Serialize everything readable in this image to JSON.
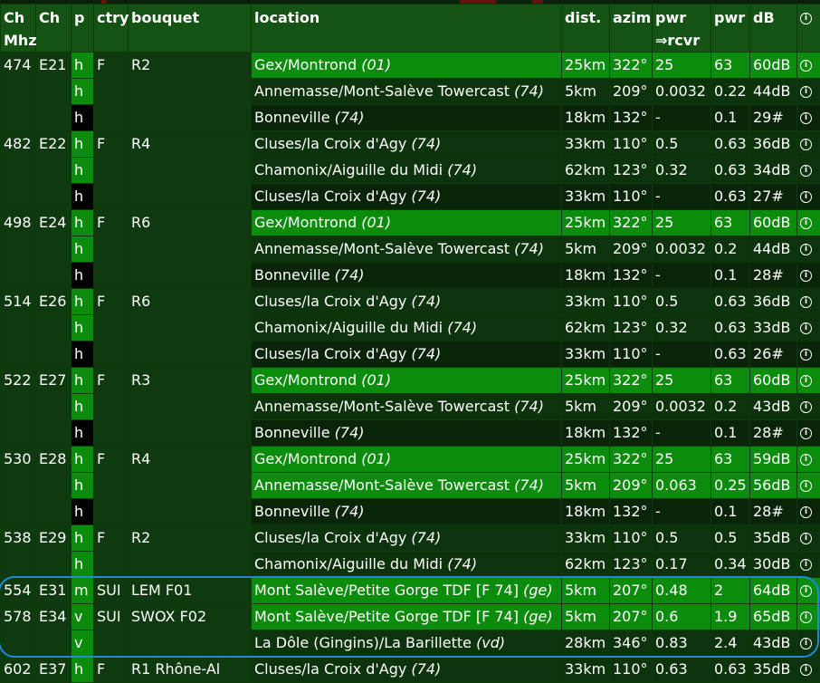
{
  "headers": {
    "ch_mhz_1": "Ch",
    "ch_mhz_2": "Mhz",
    "ch": "Ch",
    "p": "p",
    "ctry": "ctry",
    "bouquet": "bouquet",
    "location": "location",
    "dist": "dist.",
    "azim": "azim",
    "pwr_rcvr_1": "pwr",
    "pwr_rcvr_2": "⇒rcvr",
    "pwr": "pwr",
    "db": "dB",
    "info": "i"
  },
  "groups": [
    {
      "mhz": "474",
      "ch": "E21",
      "ctry": "F",
      "bouquet": "R2",
      "rows": [
        {
          "p": "h",
          "loc": "Gex/Montrond",
          "dept": "(01)",
          "dist": "25km",
          "azim": "322°",
          "pwr_rcvr": "25",
          "pwr": "63",
          "db": "60dB",
          "style": "bright"
        },
        {
          "p": "h",
          "loc": "Annemasse/Mont-Salève Towercast",
          "dept": "(74)",
          "dist": "5km",
          "azim": "209°",
          "pwr_rcvr": "0.0032",
          "pwr": "0.22",
          "db": "44dB",
          "style": "dim"
        },
        {
          "p": "h",
          "loc": "Bonneville",
          "dept": "(74)",
          "dist": "18km",
          "azim": "132°",
          "pwr_rcvr": "-",
          "pwr": "0.1",
          "db": "29#",
          "style": "dark"
        }
      ]
    },
    {
      "mhz": "482",
      "ch": "E22",
      "ctry": "F",
      "bouquet": "R4",
      "rows": [
        {
          "p": "h",
          "loc": "Cluses/la Croix d'Agy",
          "dept": "(74)",
          "dist": "33km",
          "azim": "110°",
          "pwr_rcvr": "0.5",
          "pwr": "0.63",
          "db": "36dB",
          "style": "dim"
        },
        {
          "p": "h",
          "loc": "Chamonix/Aiguille du Midi",
          "dept": "(74)",
          "dist": "62km",
          "azim": "123°",
          "pwr_rcvr": "0.32",
          "pwr": "0.63",
          "db": "34dB",
          "style": "dim"
        },
        {
          "p": "h",
          "loc": "Cluses/la Croix d'Agy",
          "dept": "(74)",
          "dist": "33km",
          "azim": "110°",
          "pwr_rcvr": "-",
          "pwr": "0.63",
          "db": "27#",
          "style": "dark"
        }
      ]
    },
    {
      "mhz": "498",
      "ch": "E24",
      "ctry": "F",
      "bouquet": "R6",
      "rows": [
        {
          "p": "h",
          "loc": "Gex/Montrond",
          "dept": "(01)",
          "dist": "25km",
          "azim": "322°",
          "pwr_rcvr": "25",
          "pwr": "63",
          "db": "60dB",
          "style": "bright"
        },
        {
          "p": "h",
          "loc": "Annemasse/Mont-Salève Towercast",
          "dept": "(74)",
          "dist": "5km",
          "azim": "209°",
          "pwr_rcvr": "0.0032",
          "pwr": "0.2",
          "db": "44dB",
          "style": "dim"
        },
        {
          "p": "h",
          "loc": "Bonneville",
          "dept": "(74)",
          "dist": "18km",
          "azim": "132°",
          "pwr_rcvr": "-",
          "pwr": "0.1",
          "db": "28#",
          "style": "dark"
        }
      ]
    },
    {
      "mhz": "514",
      "ch": "E26",
      "ctry": "F",
      "bouquet": "R6",
      "rows": [
        {
          "p": "h",
          "loc": "Cluses/la Croix d'Agy",
          "dept": "(74)",
          "dist": "33km",
          "azim": "110°",
          "pwr_rcvr": "0.5",
          "pwr": "0.63",
          "db": "36dB",
          "style": "dim"
        },
        {
          "p": "h",
          "loc": "Chamonix/Aiguille du Midi",
          "dept": "(74)",
          "dist": "62km",
          "azim": "123°",
          "pwr_rcvr": "0.32",
          "pwr": "0.63",
          "db": "33dB",
          "style": "dim"
        },
        {
          "p": "h",
          "loc": "Cluses/la Croix d'Agy",
          "dept": "(74)",
          "dist": "33km",
          "azim": "110°",
          "pwr_rcvr": "-",
          "pwr": "0.63",
          "db": "26#",
          "style": "dark"
        }
      ]
    },
    {
      "mhz": "522",
      "ch": "E27",
      "ctry": "F",
      "bouquet": "R3",
      "rows": [
        {
          "p": "h",
          "loc": "Gex/Montrond",
          "dept": "(01)",
          "dist": "25km",
          "azim": "322°",
          "pwr_rcvr": "25",
          "pwr": "63",
          "db": "60dB",
          "style": "bright"
        },
        {
          "p": "h",
          "loc": "Annemasse/Mont-Salève Towercast",
          "dept": "(74)",
          "dist": "5km",
          "azim": "209°",
          "pwr_rcvr": "0.0032",
          "pwr": "0.2",
          "db": "43dB",
          "style": "dim"
        },
        {
          "p": "h",
          "loc": "Bonneville",
          "dept": "(74)",
          "dist": "18km",
          "azim": "132°",
          "pwr_rcvr": "-",
          "pwr": "0.1",
          "db": "28#",
          "style": "dark"
        }
      ]
    },
    {
      "mhz": "530",
      "ch": "E28",
      "ctry": "F",
      "bouquet": "R4",
      "rows": [
        {
          "p": "h",
          "loc": "Gex/Montrond",
          "dept": "(01)",
          "dist": "25km",
          "azim": "322°",
          "pwr_rcvr": "25",
          "pwr": "63",
          "db": "59dB",
          "style": "bright"
        },
        {
          "p": "h",
          "loc": "Annemasse/Mont-Salève Towercast",
          "dept": "(74)",
          "dist": "5km",
          "azim": "209°",
          "pwr_rcvr": "0.063",
          "pwr": "0.25",
          "db": "56dB",
          "style": "bright"
        },
        {
          "p": "h",
          "loc": "Bonneville",
          "dept": "(74)",
          "dist": "18km",
          "azim": "132°",
          "pwr_rcvr": "-",
          "pwr": "0.1",
          "db": "28#",
          "style": "dark"
        }
      ]
    },
    {
      "mhz": "538",
      "ch": "E29",
      "ctry": "F",
      "bouquet": "R2",
      "rows": [
        {
          "p": "h",
          "loc": "Cluses/la Croix d'Agy",
          "dept": "(74)",
          "dist": "33km",
          "azim": "110°",
          "pwr_rcvr": "0.5",
          "pwr": "0.5",
          "db": "35dB",
          "style": "dim"
        },
        {
          "p": "h",
          "loc": "Chamonix/Aiguille du Midi",
          "dept": "(74)",
          "dist": "62km",
          "azim": "123°",
          "pwr_rcvr": "0.17",
          "pwr": "0.34",
          "db": "30dB",
          "style": "dim"
        }
      ]
    },
    {
      "mhz": "554",
      "ch": "E31",
      "ctry": "SUI",
      "bouquet": "LEM F01",
      "rows": [
        {
          "p": "m",
          "loc": "Mont Salève/Petite Gorge TDF [F 74]",
          "dept": "(ge)",
          "dist": "5km",
          "azim": "207°",
          "pwr_rcvr": "0.48",
          "pwr": "2",
          "db": "64dB",
          "style": "bright"
        }
      ]
    },
    {
      "mhz": "578",
      "ch": "E34",
      "ctry": "SUI",
      "bouquet": "SWOX F02",
      "rows": [
        {
          "p": "v",
          "loc": "Mont Salève/Petite Gorge TDF [F 74]",
          "dept": "(ge)",
          "dist": "5km",
          "azim": "207°",
          "pwr_rcvr": "0.6",
          "pwr": "1.9",
          "db": "65dB",
          "style": "bright"
        },
        {
          "p": "v",
          "loc": "La Dôle (Gingins)/La Barillette",
          "dept": "(vd)",
          "dist": "28km",
          "azim": "346°",
          "pwr_rcvr": "0.83",
          "pwr": "2.4",
          "db": "43dB",
          "style": "dim"
        }
      ]
    },
    {
      "mhz": "602",
      "ch": "E37",
      "ctry": "F",
      "bouquet": "R1 Rhône-Al",
      "rows": [
        {
          "p": "h",
          "loc": "Cluses/la Croix d'Agy",
          "dept": "(74)",
          "dist": "33km",
          "azim": "110°",
          "pwr_rcvr": "0.63",
          "pwr": "0.63",
          "db": "35dB",
          "style": "dim"
        }
      ]
    }
  ],
  "colors": {
    "bright_row": "#0c8c0c",
    "dim_row": "#0d330d",
    "dark_row": "#092409",
    "header": "#155315",
    "highlight": "#1e8ad8"
  },
  "icons": {
    "info": "info-circle-icon"
  }
}
